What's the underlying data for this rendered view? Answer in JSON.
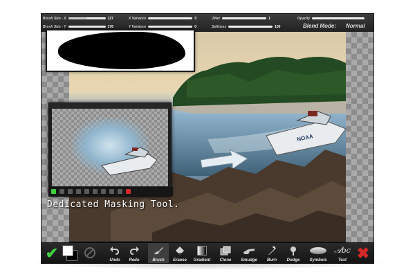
{
  "topbar": {
    "brush_size_x": {
      "label": "Brush Size - X",
      "value": "127",
      "fill": 0.5
    },
    "brush_size_y": {
      "label": "Brush Size - Y",
      "value": "176",
      "fill": 0.69
    },
    "x_variance": {
      "label": "X Variance",
      "value": "0",
      "fill": 0
    },
    "y_variance": {
      "label": "Y Variance",
      "value": "0",
      "fill": 0
    },
    "jitter": {
      "label": "Jitter",
      "value": "1",
      "fill": 0.02
    },
    "softness": {
      "label": "Softness",
      "value": "100",
      "fill": 1
    },
    "opacity": {
      "label": "Opacity",
      "value": "",
      "fill": 1
    },
    "blend_mode_label": "Blend Mode:",
    "blend_mode_value": "Normal"
  },
  "caption": "Dedicated Masking Tool.",
  "toolbar": {
    "undo": "Undo",
    "redo": "Redo",
    "tools": [
      {
        "label": "Brush",
        "icon": "brush-icon"
      },
      {
        "label": "Eraese",
        "icon": "eraser-icon"
      },
      {
        "label": "Gradient",
        "icon": "gradient-icon"
      },
      {
        "label": "Clone",
        "icon": "clone-icon"
      },
      {
        "label": "Smudge",
        "icon": "smudge-icon"
      },
      {
        "label": "Burn",
        "icon": "burn-icon"
      },
      {
        "label": "Dodge",
        "icon": "dodge-icon"
      },
      {
        "label": "Symbols",
        "icon": "symbols-icon"
      },
      {
        "label": "Text",
        "icon": "text-icon"
      }
    ],
    "active_tool": "Brush"
  },
  "colors": {
    "accent_ok": "#3ecf3e",
    "accent_cancel": "#d22a2a",
    "bar": "#232323"
  }
}
